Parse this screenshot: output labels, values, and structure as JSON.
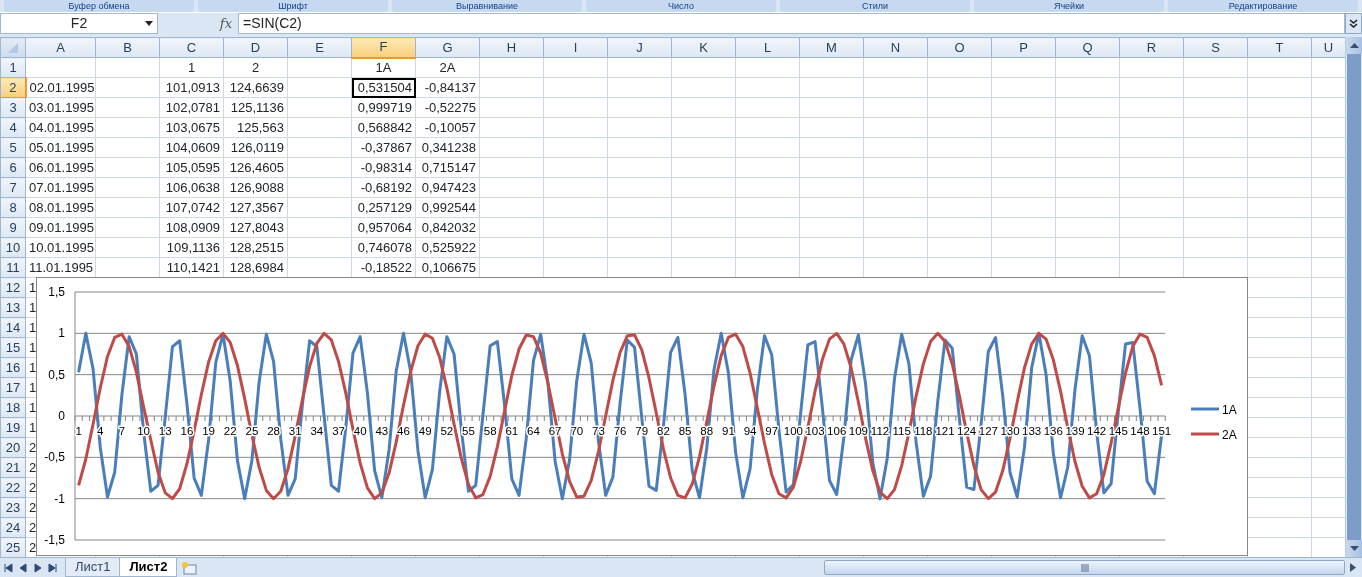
{
  "ribbon_groups": [
    "Буфер обмена",
    "Шрифт",
    "Выравнивание",
    "Число",
    "Стили",
    "Ячейки",
    "Редактирование"
  ],
  "formula_bar": {
    "name_box": "F2",
    "function_label": "fx",
    "formula": "=SIN(C2)"
  },
  "columns": [
    {
      "label": "A",
      "selected": false
    },
    {
      "label": "B",
      "selected": false
    },
    {
      "label": "C",
      "selected": false
    },
    {
      "label": "D",
      "selected": false
    },
    {
      "label": "E",
      "selected": false
    },
    {
      "label": "F",
      "selected": true
    },
    {
      "label": "G",
      "selected": false
    },
    {
      "label": "H",
      "selected": false
    },
    {
      "label": "I",
      "selected": false
    },
    {
      "label": "J",
      "selected": false
    },
    {
      "label": "K",
      "selected": false
    },
    {
      "label": "L",
      "selected": false
    },
    {
      "label": "M",
      "selected": false
    },
    {
      "label": "N",
      "selected": false
    },
    {
      "label": "O",
      "selected": false
    },
    {
      "label": "P",
      "selected": false
    },
    {
      "label": "Q",
      "selected": false
    },
    {
      "label": "R",
      "selected": false
    },
    {
      "label": "S",
      "selected": false
    },
    {
      "label": "T",
      "selected": false
    },
    {
      "label": "U",
      "selected": false
    }
  ],
  "rows": [
    {
      "number": "1",
      "selected": false,
      "col_c": "1",
      "col_d": "2",
      "col_f": "1A",
      "col_g": "2A"
    },
    {
      "number": "2",
      "selected": true,
      "col_a": "02.01.1995",
      "col_c": "101,0913",
      "col_d": "124,6639",
      "col_f": "0,531504",
      "col_g": "-0,84137"
    },
    {
      "number": "3",
      "selected": false,
      "col_a": "03.01.1995",
      "col_c": "102,0781",
      "col_d": "125,1136",
      "col_f": "0,999719",
      "col_g": "-0,52275"
    },
    {
      "number": "4",
      "selected": false,
      "col_a": "04.01.1995",
      "col_c": "103,0675",
      "col_d": "125,563",
      "col_f": "0,568842",
      "col_g": "-0,10057"
    },
    {
      "number": "5",
      "selected": false,
      "col_a": "05.01.1995",
      "col_c": "104,0609",
      "col_d": "126,0119",
      "col_f": "-0,37867",
      "col_g": "0,341238"
    },
    {
      "number": "6",
      "selected": false,
      "col_a": "06.01.1995",
      "col_c": "105,0595",
      "col_d": "126,4605",
      "col_f": "-0,98314",
      "col_g": "0,715147"
    },
    {
      "number": "7",
      "selected": false,
      "col_a": "07.01.1995",
      "col_c": "106,0638",
      "col_d": "126,9088",
      "col_f": "-0,68192",
      "col_g": "0,947423"
    },
    {
      "number": "8",
      "selected": false,
      "col_a": "08.01.1995",
      "col_c": "107,0742",
      "col_d": "127,3567",
      "col_f": "0,257129",
      "col_g": "0,992544"
    },
    {
      "number": "9",
      "selected": false,
      "col_a": "09.01.1995",
      "col_c": "108,0909",
      "col_d": "127,8043",
      "col_f": "0,957064",
      "col_g": "0,842032"
    },
    {
      "number": "10",
      "selected": false,
      "col_a": "10.01.1995",
      "col_c": "109,1136",
      "col_d": "128,2515",
      "col_f": "0,746078",
      "col_g": "0,525922"
    },
    {
      "number": "11",
      "selected": false,
      "col_a": "11.01.1995",
      "col_c": "110,1421",
      "col_d": "128,6984",
      "col_f": "-0,18522",
      "col_g": "0,106675"
    },
    {
      "number": "12",
      "selected": false,
      "col_a": "1"
    },
    {
      "number": "13",
      "selected": false,
      "col_a": "1"
    },
    {
      "number": "14",
      "selected": false,
      "col_a": "1"
    },
    {
      "number": "15",
      "selected": false,
      "col_a": "1"
    },
    {
      "number": "16",
      "selected": false,
      "col_a": "1"
    },
    {
      "number": "17",
      "selected": false,
      "col_a": "1"
    },
    {
      "number": "18",
      "selected": false,
      "col_a": "1"
    },
    {
      "number": "19",
      "selected": false,
      "col_a": "1"
    },
    {
      "number": "20",
      "selected": false,
      "col_a": "2"
    },
    {
      "number": "21",
      "selected": false,
      "col_a": "2"
    },
    {
      "number": "22",
      "selected": false,
      "col_a": "2"
    },
    {
      "number": "23",
      "selected": false,
      "col_a": "2"
    },
    {
      "number": "24",
      "selected": false,
      "col_a": "2"
    },
    {
      "number": "25",
      "selected": false,
      "col_a": "2"
    }
  ],
  "chart": {
    "chart_data": {
      "type": "line",
      "grid": true,
      "legend": "right",
      "xlim": [
        0.5,
        151.5
      ],
      "ylim": [
        -1.5,
        1.5
      ],
      "x": [
        1,
        2,
        3,
        4,
        5,
        6,
        7,
        8,
        9,
        10,
        11,
        12,
        13,
        14,
        15,
        16,
        17,
        18,
        19,
        20,
        21,
        22,
        23,
        24,
        25,
        26,
        27,
        28,
        29,
        30,
        31,
        32,
        33,
        34,
        35,
        36,
        37,
        38,
        39,
        40,
        41,
        42,
        43,
        44,
        45,
        46,
        47,
        48,
        49,
        50,
        51,
        52,
        53,
        54,
        55,
        56,
        57,
        58,
        59,
        60,
        61,
        62,
        63,
        64,
        65,
        66,
        67,
        68,
        69,
        70,
        71,
        72,
        73,
        74,
        75,
        76,
        77,
        78,
        79,
        80,
        81,
        82,
        83,
        84,
        85,
        86,
        87,
        88,
        89,
        90,
        91,
        92,
        93,
        94,
        95,
        96,
        97,
        98,
        99,
        100,
        101,
        102,
        103,
        104,
        105,
        106,
        107,
        108,
        109,
        110,
        111,
        112,
        113,
        114,
        115,
        116,
        117,
        118,
        119,
        120,
        121,
        122,
        123,
        124,
        125,
        126,
        127,
        128,
        129,
        130,
        131,
        132,
        133,
        134,
        135,
        136,
        137,
        138,
        139,
        140,
        141,
        142,
        143,
        144,
        145,
        146,
        147,
        148,
        149,
        150,
        151
      ],
      "xticks": [
        1,
        4,
        7,
        10,
        13,
        16,
        19,
        22,
        25,
        28,
        31,
        34,
        37,
        40,
        43,
        46,
        49,
        52,
        55,
        58,
        61,
        64,
        67,
        70,
        73,
        76,
        79,
        82,
        85,
        88,
        91,
        94,
        97,
        100,
        103,
        106,
        109,
        112,
        115,
        118,
        121,
        124,
        127,
        130,
        133,
        136,
        139,
        142,
        145,
        148,
        151
      ],
      "yticks": [
        {
          "value": -1.5,
          "label": "-1,5"
        },
        {
          "value": -1,
          "label": "-1"
        },
        {
          "value": -0.5,
          "label": "-0,5"
        },
        {
          "value": 0,
          "label": "0"
        },
        {
          "value": 0.5,
          "label": "0,5"
        },
        {
          "value": 1,
          "label": "1"
        },
        {
          "value": 1.5,
          "label": "1,5"
        }
      ],
      "series": [
        {
          "name": "1A",
          "color": "#4a7ebb",
          "values": [
            0.53,
            1.0,
            0.57,
            -0.38,
            -0.98,
            -0.68,
            0.26,
            0.96,
            0.75,
            -0.19,
            -0.91,
            -0.84,
            -0.01,
            0.84,
            0.91,
            0.15,
            -0.75,
            -0.96,
            -0.29,
            0.65,
            0.99,
            0.42,
            -0.54,
            -1.0,
            -0.54,
            0.41,
            0.99,
            0.66,
            -0.28,
            -0.96,
            -0.76,
            0.14,
            0.91,
            0.84,
            0.0,
            -0.84,
            -0.91,
            -0.14,
            0.76,
            0.96,
            0.28,
            -0.66,
            -0.99,
            -0.41,
            0.55,
            1.0,
            0.53,
            -0.42,
            -0.99,
            -0.65,
            0.29,
            0.96,
            0.75,
            -0.15,
            -0.91,
            -0.84,
            0.01,
            0.85,
            0.9,
            0.13,
            -0.76,
            -0.96,
            -0.27,
            0.67,
            0.99,
            0.4,
            -0.55,
            -1.0,
            -0.53,
            0.43,
            0.99,
            0.64,
            -0.3,
            -0.96,
            -0.74,
            0.16,
            0.92,
            0.83,
            -0.02,
            -0.85,
            -0.9,
            -0.12,
            0.77,
            0.95,
            0.26,
            -0.67,
            -0.99,
            -0.39,
            0.56,
            1.0,
            0.52,
            -0.44,
            -0.99,
            -0.64,
            0.31,
            0.97,
            0.74,
            -0.17,
            -0.92,
            -0.83,
            0.03,
            0.86,
            0.9,
            0.11,
            -0.78,
            -0.95,
            -0.25,
            0.68,
            0.98,
            0.39,
            -0.57,
            -1.0,
            -0.51,
            0.45,
            0.99,
            0.63,
            -0.32,
            -0.97,
            -0.73,
            0.18,
            0.92,
            0.82,
            -0.04,
            -0.86,
            -0.89,
            -0.1,
            0.78,
            0.95,
            0.24,
            -0.68,
            -0.98,
            -0.38,
            0.58,
            1.0,
            0.5,
            -0.45,
            -0.99,
            -0.62,
            0.32,
            0.97,
            0.73,
            -0.19,
            -0.93,
            -0.82,
            0.05,
            0.87,
            0.89,
            0.1,
            -0.79,
            -0.94,
            -0.23
          ]
        },
        {
          "name": "2A",
          "color": "#be4b48",
          "values": [
            -0.84,
            -0.52,
            -0.1,
            0.34,
            0.72,
            0.95,
            0.99,
            0.84,
            0.53,
            0.11,
            -0.29,
            -0.68,
            -0.93,
            -1.0,
            -0.88,
            -0.58,
            -0.18,
            0.26,
            0.65,
            0.91,
            1.0,
            0.89,
            0.61,
            0.21,
            -0.23,
            -0.62,
            -0.9,
            -1.0,
            -0.91,
            -0.64,
            -0.24,
            0.2,
            0.6,
            0.88,
            1.0,
            0.92,
            0.66,
            0.28,
            -0.16,
            -0.57,
            -0.87,
            -1.0,
            -0.93,
            -0.69,
            -0.31,
            0.13,
            0.54,
            0.85,
            0.99,
            0.94,
            0.71,
            0.34,
            -0.1,
            -0.51,
            -0.83,
            -0.99,
            -0.95,
            -0.73,
            -0.37,
            0.06,
            0.49,
            0.81,
            0.98,
            0.96,
            0.76,
            0.4,
            -0.03,
            -0.46,
            -0.79,
            -0.98,
            -0.97,
            -0.78,
            -0.43,
            0.0,
            0.43,
            0.77,
            0.97,
            0.98,
            0.8,
            0.46,
            0.04,
            -0.4,
            -0.75,
            -0.96,
            -0.99,
            -0.82,
            -0.49,
            -0.07,
            0.36,
            0.73,
            0.95,
            0.99,
            0.84,
            0.52,
            0.1,
            -0.33,
            -0.71,
            -0.94,
            -0.99,
            -0.86,
            -0.55,
            -0.14,
            0.3,
            0.68,
            0.93,
            1.0,
            0.87,
            0.58,
            0.17,
            -0.27,
            -0.66,
            -0.92,
            -1.0,
            -0.89,
            -0.6,
            -0.2,
            0.24,
            0.63,
            0.9,
            1.0,
            0.9,
            0.63,
            0.24,
            -0.2,
            -0.6,
            -0.89,
            -1.0,
            -0.92,
            -0.66,
            -0.27,
            0.17,
            0.58,
            0.87,
            1.0,
            0.93,
            0.68,
            0.3,
            -0.14,
            -0.55,
            -0.85,
            -0.99,
            -0.94,
            -0.71,
            -0.33,
            0.1,
            0.52,
            0.84,
            0.99,
            0.95,
            0.73,
            0.37
          ]
        }
      ]
    }
  },
  "sheet_tabs": [
    {
      "label": "Лист1",
      "selected": false
    },
    {
      "label": "Лист2",
      "selected": true
    }
  ]
}
